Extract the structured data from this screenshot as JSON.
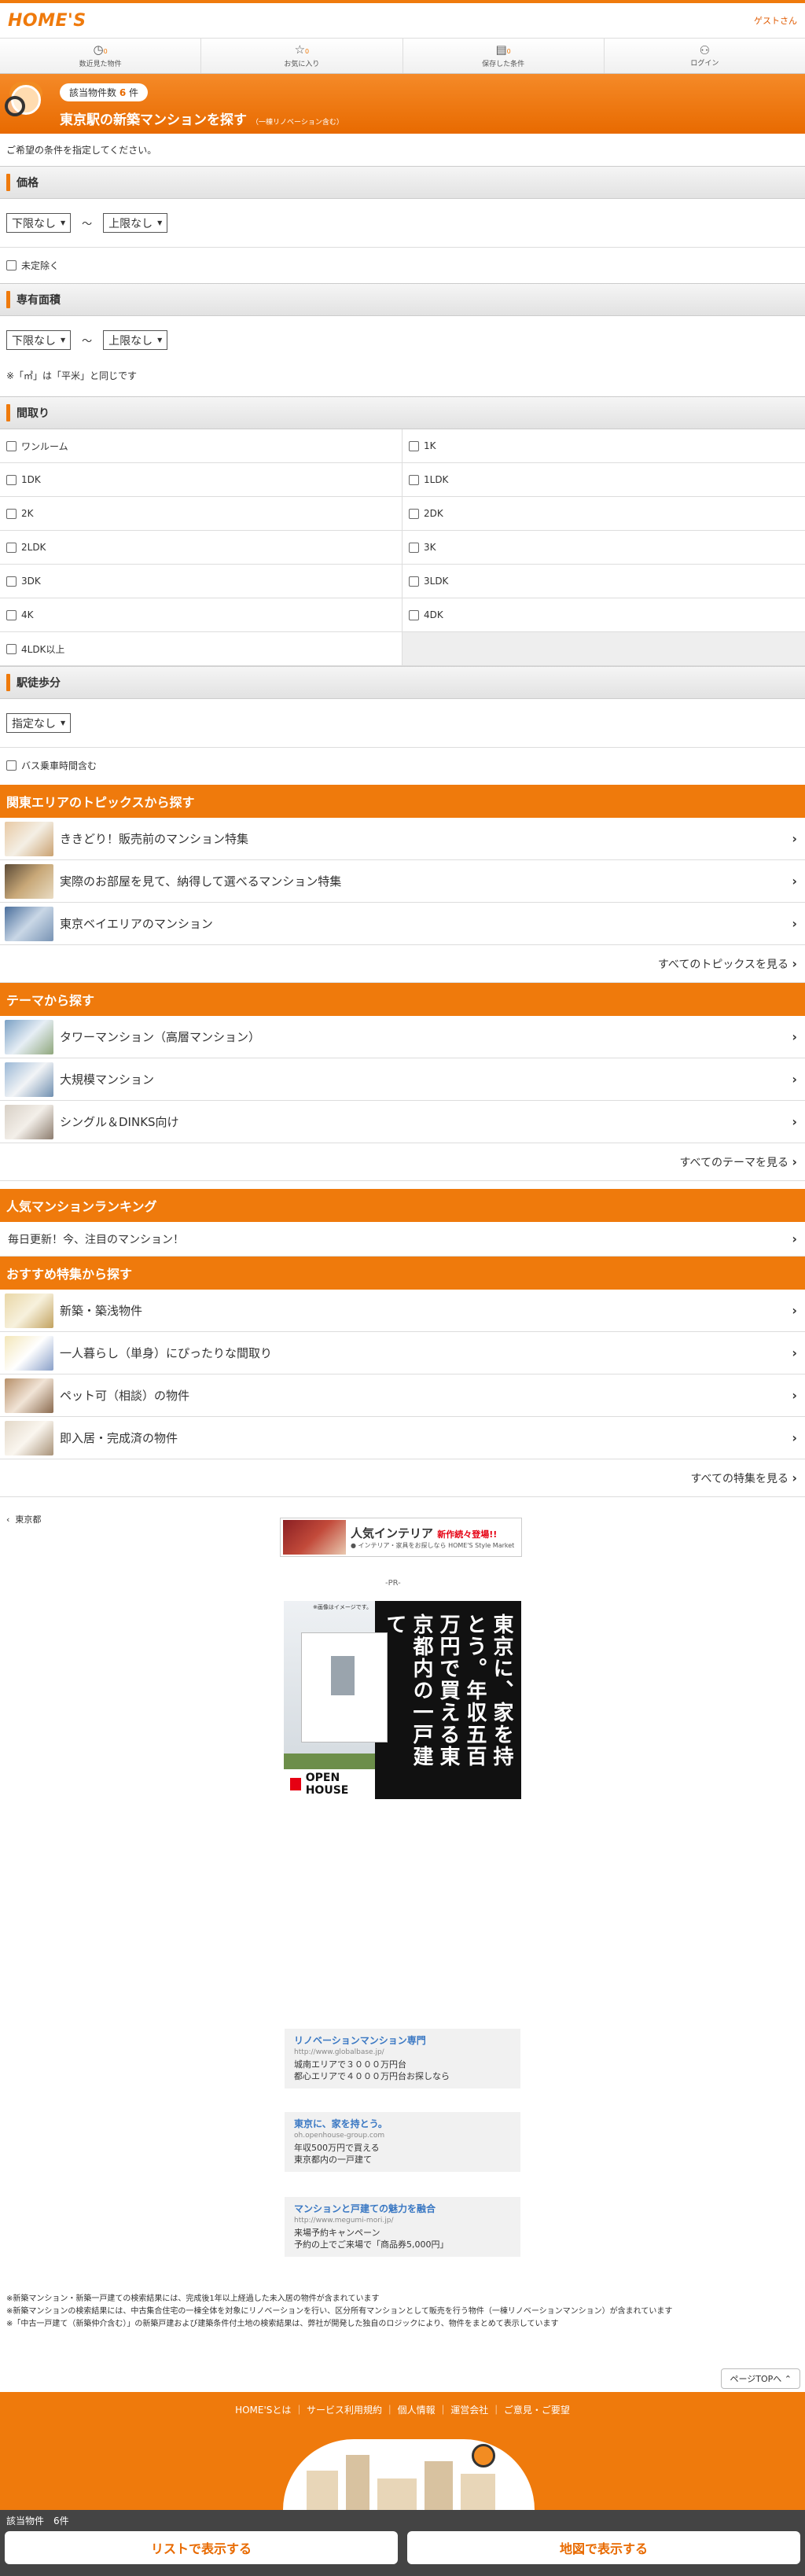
{
  "header": {
    "logo": "HOME'S",
    "guest": "ゲストさん"
  },
  "nav": [
    {
      "label": "数近見た物件",
      "count": "0",
      "icon": "clock-icon",
      "glyph": "◷"
    },
    {
      "label": "お気に入り",
      "count": "0",
      "icon": "star-icon",
      "glyph": "☆"
    },
    {
      "label": "保存した条件",
      "count": "0",
      "icon": "memo-icon",
      "glyph": "▤"
    },
    {
      "label": "ログイン",
      "count": "",
      "icon": "person-icon",
      "glyph": "⚇"
    }
  ],
  "hero": {
    "count_prefix": "該当物件数",
    "count": "6",
    "count_suffix": "件",
    "title": "東京駅の新築マンションを探す",
    "subtitle": "（一棟リノベーション含む）"
  },
  "intro": "ご希望の条件を指定してください。",
  "price": {
    "heading": "価格",
    "min": "下限なし",
    "max": "上限なし",
    "tilde": "～",
    "undecided": "未定除く"
  },
  "area": {
    "heading": "専有面積",
    "min": "下限なし",
    "max": "上限なし",
    "tilde": "～",
    "note": "※「㎡」は「平米」と同じです"
  },
  "layout": {
    "heading": "間取り",
    "options": [
      "ワンルーム",
      "1K",
      "1DK",
      "1LDK",
      "2K",
      "2DK",
      "2LDK",
      "3K",
      "3DK",
      "3LDK",
      "4K",
      "4DK",
      "4LDK以上"
    ]
  },
  "walk": {
    "heading": "駅徒歩分",
    "select": "指定なし",
    "bus": "バス乗車時間含む"
  },
  "topics": {
    "heading": "関東エリアのトピックスから探す",
    "items": [
      "ききどり！販売前のマンション特集",
      "実際のお部屋を見て、納得して選べるマンション特集",
      "東京ベイエリアのマンション"
    ],
    "more": "すべてのトピックスを見る"
  },
  "themes": {
    "heading": "テーマから探す",
    "items": [
      "タワーマンション（高層マンション）",
      "大規模マンション",
      "シングル＆DINKS向け"
    ],
    "more": "すべてのテーマを見る"
  },
  "ranking": {
    "heading": "人気マンションランキング",
    "item": "毎日更新！今、注目のマンション！"
  },
  "features": {
    "heading": "おすすめ特集から探す",
    "items": [
      "新築・築浅物件",
      "一人暮らし（単身）にぴったりな間取り",
      "ペット可（相談）の物件",
      "即入居・完成済の物件"
    ],
    "more": "すべての特集を見る"
  },
  "back": "東京都",
  "banner": {
    "title": "人気インテリア",
    "tag": "新作続々登場!!",
    "sub": "● インテリア・家具をお探しなら HOME'S Style Market"
  },
  "pr": "-PR-",
  "ad": {
    "caption": "※画像はイメージです。",
    "copy": "東京に、家を持とう。年収五百万円で買える東京都内の一戸建て",
    "brand": "OPEN HOUSE"
  },
  "text_ads": [
    {
      "title": "リノベーションマンション専門",
      "url": "http://www.globalbase.jp/",
      "l1": "城南エリアで３０００万円台",
      "l2": "都心エリアで４０００万円台お探しなら"
    },
    {
      "title": "東京に、家を持とう。",
      "url": "oh.openhouse-group.com",
      "l1": "年収500万円で買える",
      "l2": "東京都内の一戸建て"
    },
    {
      "title": "マンションと戸建ての魅力を融合",
      "url": "http://www.megumi-mori.jp/",
      "l1": "来場予約キャンペーン",
      "l2": "予約の上でご来場で「商品券5,000円」"
    }
  ],
  "notes": [
    "※新築マンション・新築一戸建ての検索結果には、完成後1年以上経過した未入居の物件が含まれています",
    "※新築マンションの検索結果には、中古集合住宅の一棟全体を対象にリノベーションを行い、区分所有マンションとして販売を行う物件（一棟リノベーションマンション）が含まれています",
    "※「中古一戸建て（新築仲介含む）」の新築戸建および建築条件付土地の検索結果は、弊社が開発した独自のロジックにより、物件をまとめて表示しています"
  ],
  "pagetop": "ページTOPへ ⌃",
  "footer": {
    "links": "HOME'Sとは ｜ サービス利用規約 ｜ 個人情報 ｜ 運営会社 ｜ ご意見・ご要望"
  },
  "bottom": {
    "count": "該当物件　6件",
    "list_btn": "リストで表示する",
    "map_btn": "地図で表示する"
  }
}
